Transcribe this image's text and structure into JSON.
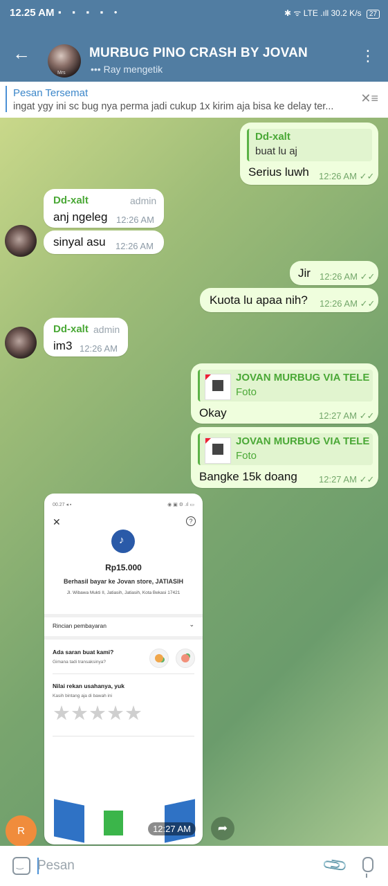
{
  "status_bar": {
    "time": "12.25 AM",
    "left_icons": "▪ ▪ ▪ ▪ •",
    "right_text": "✱ ᯤ LTE .ıll 30.2 K/s",
    "battery": "27"
  },
  "header": {
    "back_icon": "←",
    "avatar_tag": "Mrs",
    "title": "MURBUG PINO CRASH BY JOVAN",
    "subtitle": "••• Ray mengetik",
    "menu_icon": "⋮"
  },
  "pinned": {
    "title": "Pesan Tersemat",
    "text": "ingat ygy ini sc bug nya perma jadi cukup 1x kirim aja bisa ke delay ter...",
    "unpin_icon": "✕≡"
  },
  "messages": [
    {
      "reply_name": "Dd-xalt",
      "reply_text": "buat lu aj",
      "text": "Serius luwh",
      "time": "12:26 AM"
    },
    {
      "sender": "Dd-xalt",
      "role": "admin",
      "text": "anj ngeleg",
      "time": "12:26 AM"
    },
    {
      "text": "sinyal asu",
      "time": "12:26 AM"
    },
    {
      "text": "Jir",
      "time": "12:26 AM"
    },
    {
      "text": "Kuota lu apaa nih?",
      "time": "12:26 AM"
    },
    {
      "sender": "Dd-xalt",
      "role": "admin",
      "text": "im3",
      "time": "12:26 AM"
    },
    {
      "reply_name": "JOVAN MURBUG VIA TELE",
      "reply_text": "Foto",
      "text": "Okay",
      "time": "12:27 AM"
    },
    {
      "reply_name": "JOVAN MURBUG VIA TELE",
      "reply_text": "Foto",
      "text": "Bangke 15k doang",
      "time": "12:27 AM"
    }
  ],
  "read_ticks": "✓✓",
  "photo": {
    "top_left": "00.27 ◂ ▪",
    "top_right": "◉ ▣ ⚙ .ıl ▭",
    "close": "✕",
    "help": "?",
    "amount": "Rp15.000",
    "paid_to": "Berhasil bayar ke Jovan store, JATIASIH",
    "address": "Jl. Wibawa Mukti II, Jatiasih, Jatiasih, Kota Bekasi 17421",
    "details": "Rincian pembayaran",
    "details_icon": "⌄",
    "suggest_title": "Ada saran buat kami?",
    "suggest_sub": "Gimana tadi transaksinya?",
    "rate_title": "Nilai rekan usahanya, yuk",
    "rate_sub": "Kasih bintang aja di bawah ini",
    "rating_stars": 0,
    "stars": "★★★★★",
    "time": "12:27 AM"
  },
  "forward_icon": "➦",
  "user_avatar_letter": "R",
  "input": {
    "placeholder": "Pesan",
    "attach_icon": "📎"
  }
}
